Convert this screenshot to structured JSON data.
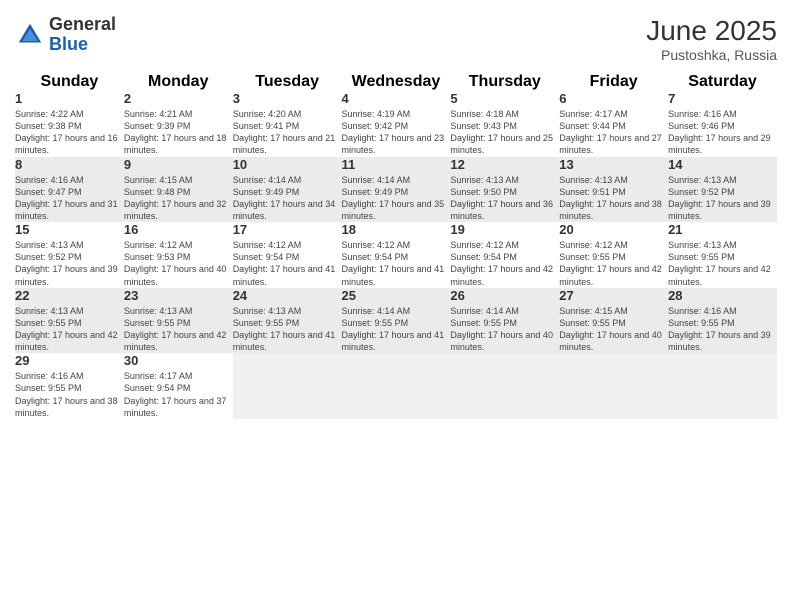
{
  "header": {
    "logo_general": "General",
    "logo_blue": "Blue",
    "month_year": "June 2025",
    "location": "Pustoshka, Russia"
  },
  "weekdays": [
    "Sunday",
    "Monday",
    "Tuesday",
    "Wednesday",
    "Thursday",
    "Friday",
    "Saturday"
  ],
  "weeks": [
    [
      {
        "day": "1",
        "info": "Sunrise: 4:22 AM\nSunset: 9:38 PM\nDaylight: 17 hours and 16 minutes."
      },
      {
        "day": "2",
        "info": "Sunrise: 4:21 AM\nSunset: 9:39 PM\nDaylight: 17 hours and 18 minutes."
      },
      {
        "day": "3",
        "info": "Sunrise: 4:20 AM\nSunset: 9:41 PM\nDaylight: 17 hours and 21 minutes."
      },
      {
        "day": "4",
        "info": "Sunrise: 4:19 AM\nSunset: 9:42 PM\nDaylight: 17 hours and 23 minutes."
      },
      {
        "day": "5",
        "info": "Sunrise: 4:18 AM\nSunset: 9:43 PM\nDaylight: 17 hours and 25 minutes."
      },
      {
        "day": "6",
        "info": "Sunrise: 4:17 AM\nSunset: 9:44 PM\nDaylight: 17 hours and 27 minutes."
      },
      {
        "day": "7",
        "info": "Sunrise: 4:16 AM\nSunset: 9:46 PM\nDaylight: 17 hours and 29 minutes."
      }
    ],
    [
      {
        "day": "8",
        "info": "Sunrise: 4:16 AM\nSunset: 9:47 PM\nDaylight: 17 hours and 31 minutes."
      },
      {
        "day": "9",
        "info": "Sunrise: 4:15 AM\nSunset: 9:48 PM\nDaylight: 17 hours and 32 minutes."
      },
      {
        "day": "10",
        "info": "Sunrise: 4:14 AM\nSunset: 9:49 PM\nDaylight: 17 hours and 34 minutes."
      },
      {
        "day": "11",
        "info": "Sunrise: 4:14 AM\nSunset: 9:49 PM\nDaylight: 17 hours and 35 minutes."
      },
      {
        "day": "12",
        "info": "Sunrise: 4:13 AM\nSunset: 9:50 PM\nDaylight: 17 hours and 36 minutes."
      },
      {
        "day": "13",
        "info": "Sunrise: 4:13 AM\nSunset: 9:51 PM\nDaylight: 17 hours and 38 minutes."
      },
      {
        "day": "14",
        "info": "Sunrise: 4:13 AM\nSunset: 9:52 PM\nDaylight: 17 hours and 39 minutes."
      }
    ],
    [
      {
        "day": "15",
        "info": "Sunrise: 4:13 AM\nSunset: 9:52 PM\nDaylight: 17 hours and 39 minutes."
      },
      {
        "day": "16",
        "info": "Sunrise: 4:12 AM\nSunset: 9:53 PM\nDaylight: 17 hours and 40 minutes."
      },
      {
        "day": "17",
        "info": "Sunrise: 4:12 AM\nSunset: 9:54 PM\nDaylight: 17 hours and 41 minutes."
      },
      {
        "day": "18",
        "info": "Sunrise: 4:12 AM\nSunset: 9:54 PM\nDaylight: 17 hours and 41 minutes."
      },
      {
        "day": "19",
        "info": "Sunrise: 4:12 AM\nSunset: 9:54 PM\nDaylight: 17 hours and 42 minutes."
      },
      {
        "day": "20",
        "info": "Sunrise: 4:12 AM\nSunset: 9:55 PM\nDaylight: 17 hours and 42 minutes."
      },
      {
        "day": "21",
        "info": "Sunrise: 4:13 AM\nSunset: 9:55 PM\nDaylight: 17 hours and 42 minutes."
      }
    ],
    [
      {
        "day": "22",
        "info": "Sunrise: 4:13 AM\nSunset: 9:55 PM\nDaylight: 17 hours and 42 minutes."
      },
      {
        "day": "23",
        "info": "Sunrise: 4:13 AM\nSunset: 9:55 PM\nDaylight: 17 hours and 42 minutes."
      },
      {
        "day": "24",
        "info": "Sunrise: 4:13 AM\nSunset: 9:55 PM\nDaylight: 17 hours and 41 minutes."
      },
      {
        "day": "25",
        "info": "Sunrise: 4:14 AM\nSunset: 9:55 PM\nDaylight: 17 hours and 41 minutes."
      },
      {
        "day": "26",
        "info": "Sunrise: 4:14 AM\nSunset: 9:55 PM\nDaylight: 17 hours and 40 minutes."
      },
      {
        "day": "27",
        "info": "Sunrise: 4:15 AM\nSunset: 9:55 PM\nDaylight: 17 hours and 40 minutes."
      },
      {
        "day": "28",
        "info": "Sunrise: 4:16 AM\nSunset: 9:55 PM\nDaylight: 17 hours and 39 minutes."
      }
    ],
    [
      {
        "day": "29",
        "info": "Sunrise: 4:16 AM\nSunset: 9:55 PM\nDaylight: 17 hours and 38 minutes."
      },
      {
        "day": "30",
        "info": "Sunrise: 4:17 AM\nSunset: 9:54 PM\nDaylight: 17 hours and 37 minutes."
      },
      null,
      null,
      null,
      null,
      null
    ]
  ]
}
